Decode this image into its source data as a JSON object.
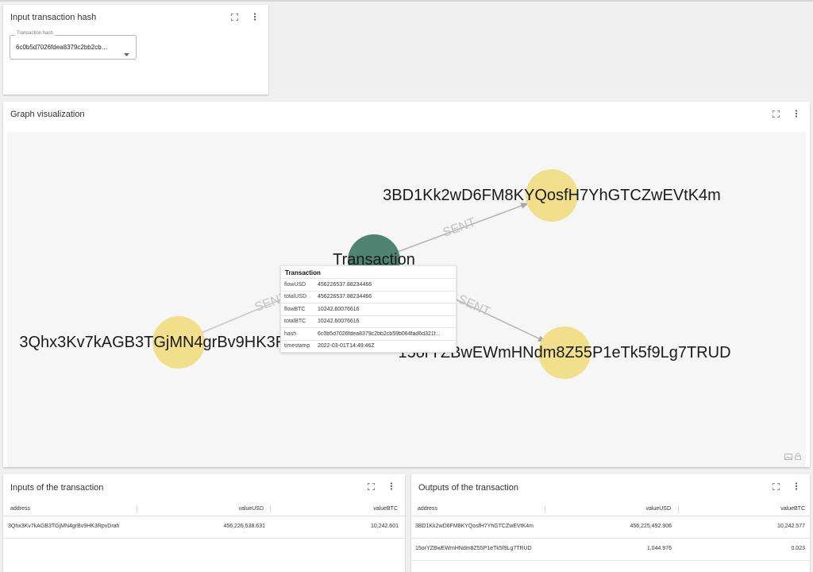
{
  "input_card": {
    "title": "Input transaction hash",
    "select_label": "Transaction hash",
    "select_value": "6c0b5d7026fdea8379c2bb2cb59b064fad6d321f..."
  },
  "graph_card": {
    "title": "Graph visualization",
    "nodes": {
      "transaction": "Transaction",
      "out1": "3BD1Kk2wD6FM8KYQosfH7YhGTCZwEVtK4m",
      "out2": "15orYZBwEWmHNdm8Z55P1eTk5f9Lg7TRUD",
      "in1": "3Qhx3Kv7kAGB3TGjMN4grBv9HK3RpvDrah"
    },
    "edge_label": "SENT",
    "colors": {
      "transaction_node": "#4f8372",
      "address_node": "#f2df8c"
    },
    "tooltip": {
      "title": "Transaction",
      "rows": [
        {
          "key": "flowUSD",
          "value": "456226537.88234466"
        },
        {
          "key": "totalUSD",
          "value": "456226537.88234466"
        },
        {
          "key": "flowBTC",
          "value": "10242.60076616"
        },
        {
          "key": "totalBTC",
          "value": "10242.60076616"
        },
        {
          "key": "hash",
          "value": "6c0b5d7026fdea8379c2bb2cb59b064fad6d321f..."
        },
        {
          "key": "timestamp",
          "value": "2022-03-01T14:49:46Z"
        }
      ]
    }
  },
  "inputs_card": {
    "title": "Inputs of the transaction",
    "columns": [
      "address",
      "valueUSD",
      "valueBTC"
    ],
    "rows": [
      {
        "address": "3Qhx3Kv7kAGB3TGjMN4grBv9HK3RpvDrah",
        "valueUSD": "456,226,538.631",
        "valueBTC": "10,242.601"
      }
    ]
  },
  "outputs_card": {
    "title": "Outputs of the transaction",
    "columns": [
      "address",
      "valueUSD",
      "valueBTC"
    ],
    "rows": [
      {
        "address": "3BD1Kk2wD6FM8KYQosfH7YhGTCZwEVtK4m",
        "valueUSD": "456,225,492.906",
        "valueBTC": "10,242.577"
      },
      {
        "address": "15orYZBwEWmHNdm8Z55P1eTk5f9Lg7TRUD",
        "valueUSD": "1,044.976",
        "valueBTC": "0.023"
      }
    ]
  }
}
